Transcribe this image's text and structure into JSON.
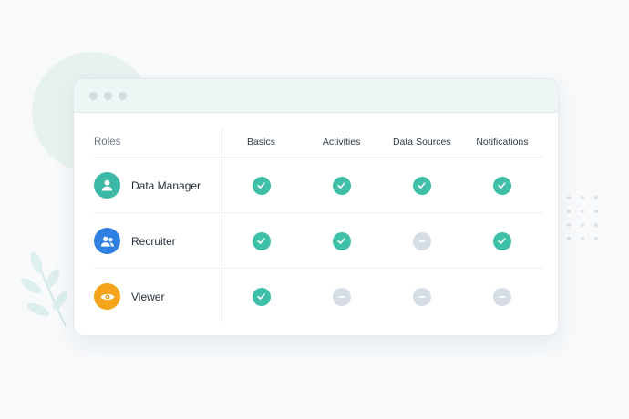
{
  "colors": {
    "check": "#3dbfa8",
    "dash": "#d7dde4",
    "data_manager_avatar": "#3cb9a6",
    "recruiter_avatar": "#2f80e0",
    "viewer_avatar": "#f5a31a"
  },
  "table": {
    "roles_header": "Roles",
    "columns": [
      "Basics",
      "Activities",
      "Data Sources",
      "Notifications"
    ],
    "rows": [
      {
        "name": "Data Manager",
        "icon": "user-icon",
        "permissions": [
          "check",
          "check",
          "check",
          "check"
        ]
      },
      {
        "name": "Recruiter",
        "icon": "users-icon",
        "permissions": [
          "check",
          "check",
          "dash",
          "check"
        ]
      },
      {
        "name": "Viewer",
        "icon": "eye-icon",
        "permissions": [
          "check",
          "dash",
          "dash",
          "dash"
        ]
      }
    ]
  }
}
